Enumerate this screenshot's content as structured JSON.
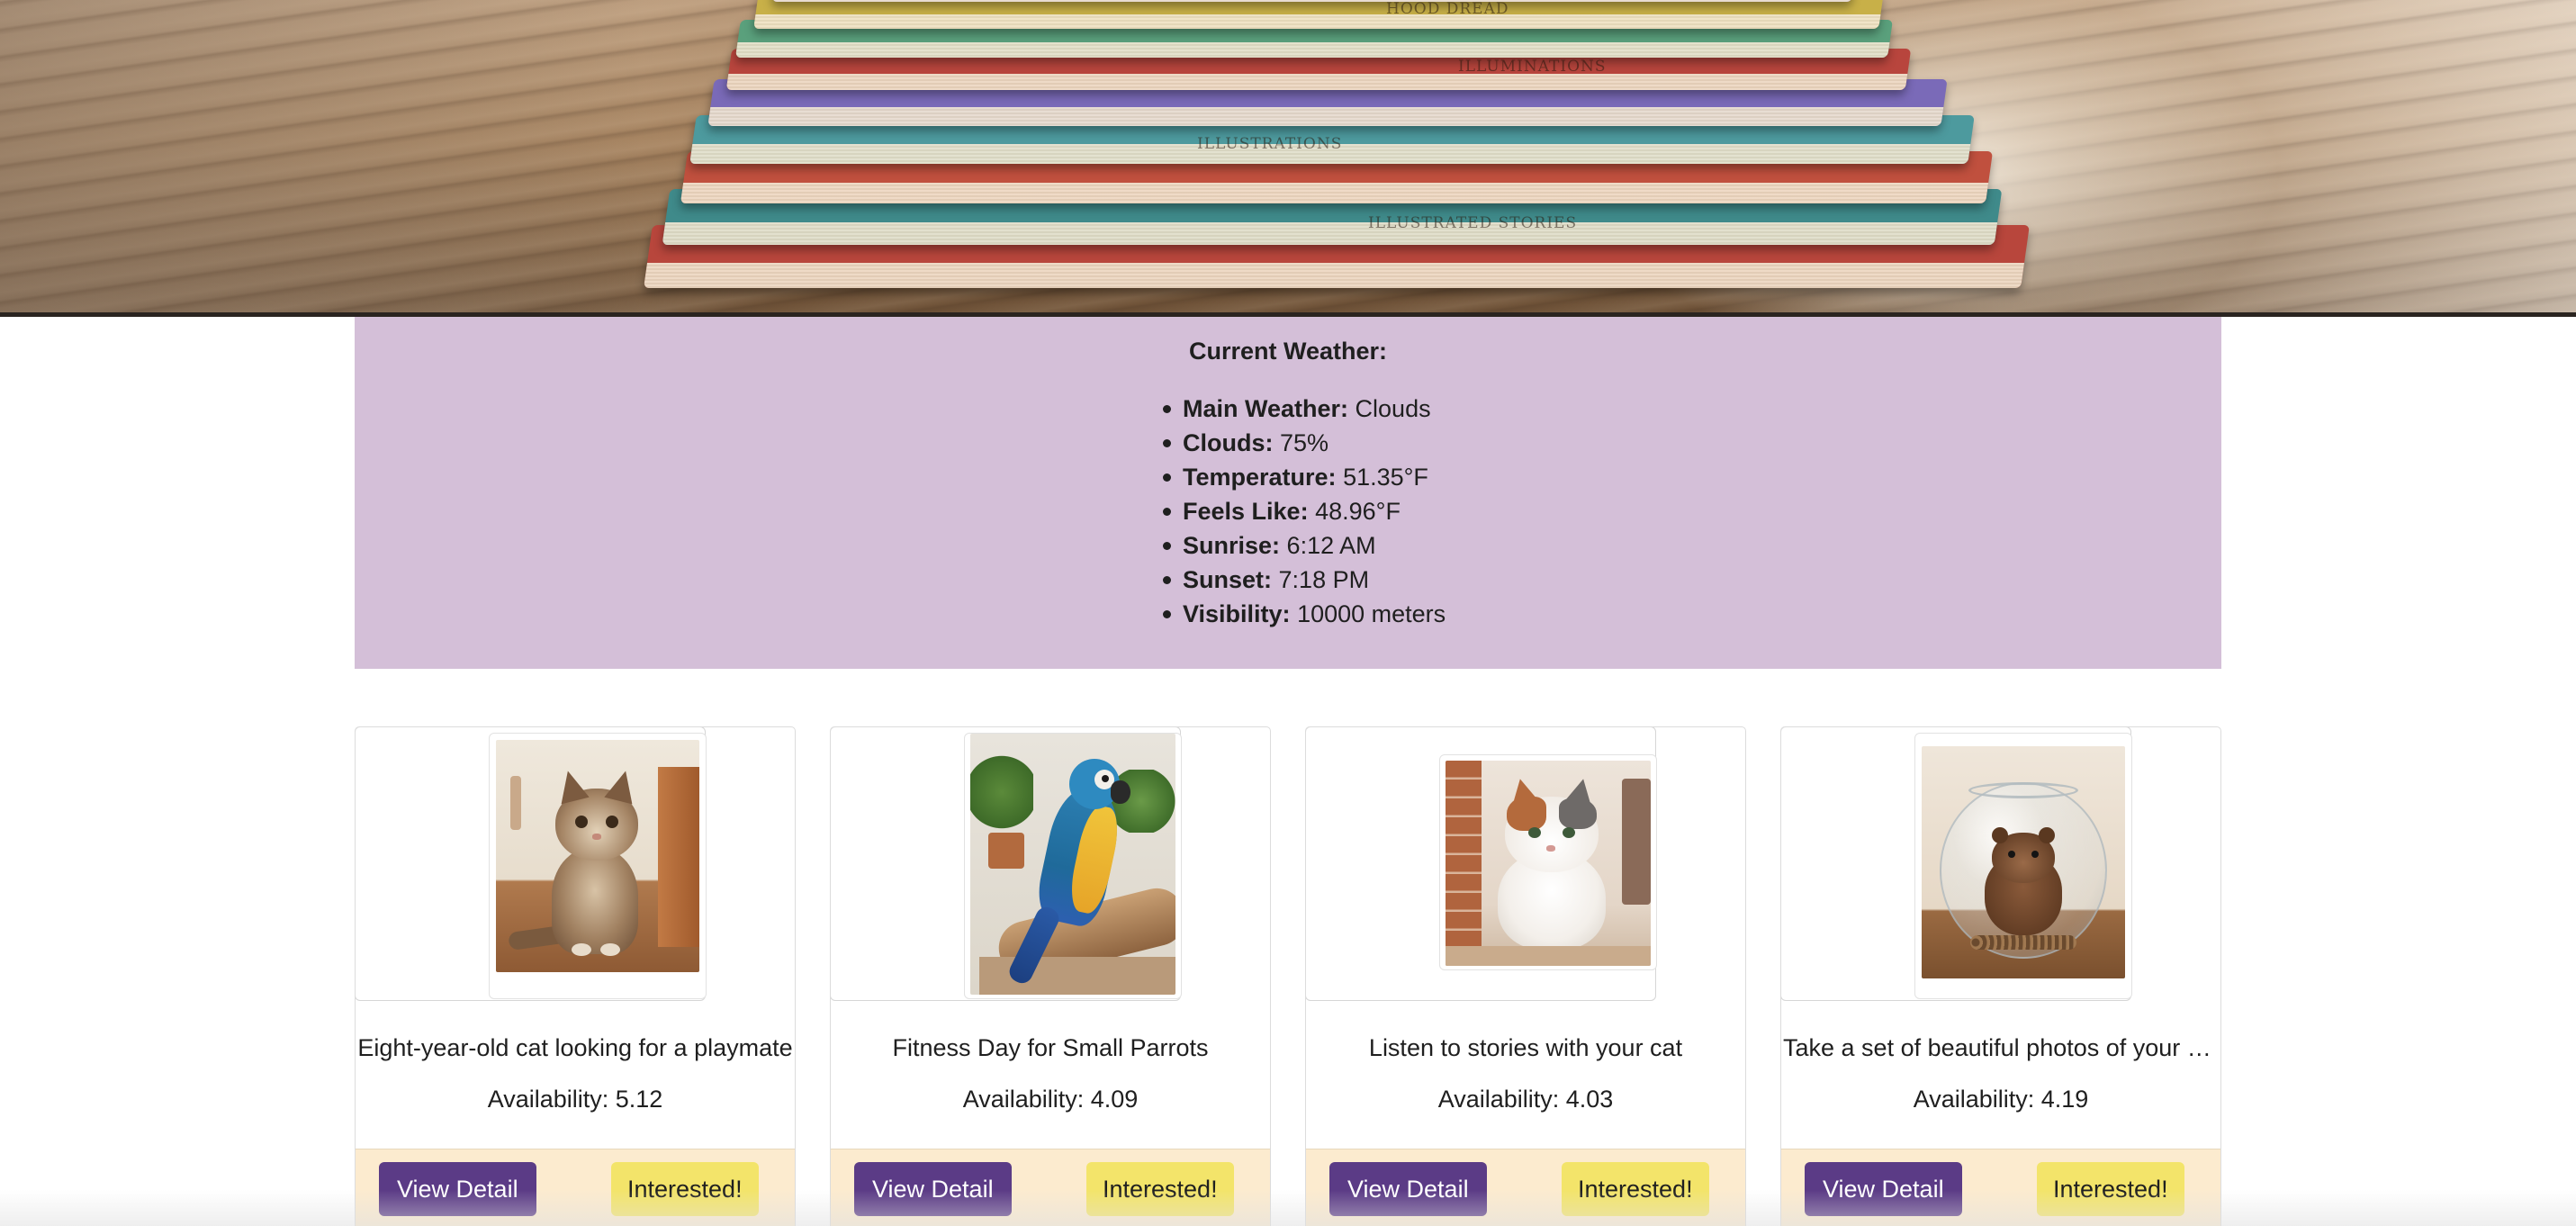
{
  "weather": {
    "title": "Current Weather:",
    "items": [
      {
        "label": "Main Weather:",
        "value": "Clouds"
      },
      {
        "label": "Clouds:",
        "value": "75%"
      },
      {
        "label": "Temperature:",
        "value": "51.35°F"
      },
      {
        "label": "Feels Like:",
        "value": "48.96°F"
      },
      {
        "label": "Sunrise:",
        "value": "6:12 AM"
      },
      {
        "label": "Sunset:",
        "value": "7:18 PM"
      },
      {
        "label": "Visibility:",
        "value": "10000 meters"
      }
    ]
  },
  "cards": [
    {
      "title": "Eight-year-old cat looking for a playmate",
      "availability": "Availability: 5.12",
      "detail_label": "View Detail",
      "interested_label": "Interested!",
      "image": "kitten-photo"
    },
    {
      "title": "Fitness Day for Small Parrots",
      "availability": "Availability: 4.09",
      "detail_label": "View Detail",
      "interested_label": "Interested!",
      "image": "parrot-photo"
    },
    {
      "title": "Listen to stories with your cat",
      "availability": "Availability: 4.03",
      "detail_label": "View Detail",
      "interested_label": "Interested!",
      "image": "cat-photo"
    },
    {
      "title": "Take a set of beautiful photos of your pet",
      "availability": "Availability: 4.19",
      "detail_label": "View Detail",
      "interested_label": "Interested!",
      "image": "ferret-in-bowl-photo"
    }
  ],
  "colors": {
    "weather_bg": "#d4bfd8",
    "primary_button": "#5b3b86",
    "secondary_button": "#f3e46a",
    "card_footer": "#fcebcf"
  }
}
